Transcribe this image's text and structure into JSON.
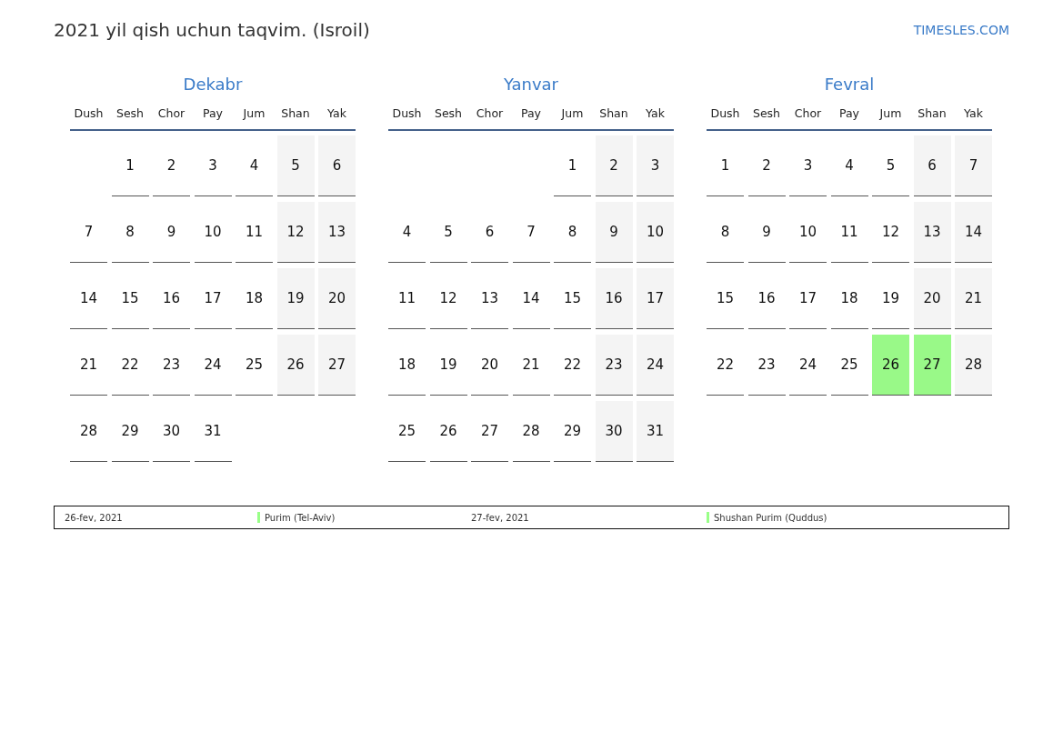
{
  "title": "2021 yil qish uchun taqvim. (Isroil)",
  "site": "TIMESLES.COM",
  "months": [
    {
      "name": "Dekabr",
      "weekdays": [
        "Dush",
        "Sesh",
        "Chor",
        "Pay",
        "Jum",
        "Shan",
        "Yak"
      ],
      "weeks": [
        [
          {
            "kind": "blank"
          },
          {
            "kind": "day",
            "day": "1"
          },
          {
            "kind": "day",
            "day": "2"
          },
          {
            "kind": "day",
            "day": "3"
          },
          {
            "kind": "day",
            "day": "4"
          },
          {
            "kind": "weekend",
            "day": "5"
          },
          {
            "kind": "weekend",
            "day": "6"
          }
        ],
        [
          {
            "kind": "day",
            "day": "7"
          },
          {
            "kind": "day",
            "day": "8"
          },
          {
            "kind": "day",
            "day": "9"
          },
          {
            "kind": "day",
            "day": "10"
          },
          {
            "kind": "day",
            "day": "11"
          },
          {
            "kind": "weekend",
            "day": "12"
          },
          {
            "kind": "weekend",
            "day": "13"
          }
        ],
        [
          {
            "kind": "day",
            "day": "14"
          },
          {
            "kind": "day",
            "day": "15"
          },
          {
            "kind": "day",
            "day": "16"
          },
          {
            "kind": "day",
            "day": "17"
          },
          {
            "kind": "day",
            "day": "18"
          },
          {
            "kind": "weekend",
            "day": "19"
          },
          {
            "kind": "weekend",
            "day": "20"
          }
        ],
        [
          {
            "kind": "day",
            "day": "21"
          },
          {
            "kind": "day",
            "day": "22"
          },
          {
            "kind": "day",
            "day": "23"
          },
          {
            "kind": "day",
            "day": "24"
          },
          {
            "kind": "day",
            "day": "25"
          },
          {
            "kind": "weekend",
            "day": "26"
          },
          {
            "kind": "weekend",
            "day": "27"
          }
        ],
        [
          {
            "kind": "day",
            "day": "28"
          },
          {
            "kind": "day",
            "day": "29"
          },
          {
            "kind": "day",
            "day": "30"
          },
          {
            "kind": "day",
            "day": "31"
          },
          {
            "kind": "blank"
          },
          {
            "kind": "blank"
          },
          {
            "kind": "blank"
          }
        ]
      ]
    },
    {
      "name": "Yanvar",
      "weekdays": [
        "Dush",
        "Sesh",
        "Chor",
        "Pay",
        "Jum",
        "Shan",
        "Yak"
      ],
      "weeks": [
        [
          {
            "kind": "blank"
          },
          {
            "kind": "blank"
          },
          {
            "kind": "blank"
          },
          {
            "kind": "blank"
          },
          {
            "kind": "day",
            "day": "1"
          },
          {
            "kind": "weekend",
            "day": "2"
          },
          {
            "kind": "weekend",
            "day": "3"
          }
        ],
        [
          {
            "kind": "day",
            "day": "4"
          },
          {
            "kind": "day",
            "day": "5"
          },
          {
            "kind": "day",
            "day": "6"
          },
          {
            "kind": "day",
            "day": "7"
          },
          {
            "kind": "day",
            "day": "8"
          },
          {
            "kind": "weekend",
            "day": "9"
          },
          {
            "kind": "weekend",
            "day": "10"
          }
        ],
        [
          {
            "kind": "day",
            "day": "11"
          },
          {
            "kind": "day",
            "day": "12"
          },
          {
            "kind": "day",
            "day": "13"
          },
          {
            "kind": "day",
            "day": "14"
          },
          {
            "kind": "day",
            "day": "15"
          },
          {
            "kind": "weekend",
            "day": "16"
          },
          {
            "kind": "weekend",
            "day": "17"
          }
        ],
        [
          {
            "kind": "day",
            "day": "18"
          },
          {
            "kind": "day",
            "day": "19"
          },
          {
            "kind": "day",
            "day": "20"
          },
          {
            "kind": "day",
            "day": "21"
          },
          {
            "kind": "day",
            "day": "22"
          },
          {
            "kind": "weekend",
            "day": "23"
          },
          {
            "kind": "weekend",
            "day": "24"
          }
        ],
        [
          {
            "kind": "day",
            "day": "25"
          },
          {
            "kind": "day",
            "day": "26"
          },
          {
            "kind": "day",
            "day": "27"
          },
          {
            "kind": "day",
            "day": "28"
          },
          {
            "kind": "day",
            "day": "29"
          },
          {
            "kind": "weekend",
            "day": "30"
          },
          {
            "kind": "weekend",
            "day": "31"
          }
        ]
      ]
    },
    {
      "name": "Fevral",
      "weekdays": [
        "Dush",
        "Sesh",
        "Chor",
        "Pay",
        "Jum",
        "Shan",
        "Yak"
      ],
      "weeks": [
        [
          {
            "kind": "day",
            "day": "1"
          },
          {
            "kind": "day",
            "day": "2"
          },
          {
            "kind": "day",
            "day": "3"
          },
          {
            "kind": "day",
            "day": "4"
          },
          {
            "kind": "day",
            "day": "5"
          },
          {
            "kind": "weekend",
            "day": "6"
          },
          {
            "kind": "weekend",
            "day": "7"
          }
        ],
        [
          {
            "kind": "day",
            "day": "8"
          },
          {
            "kind": "day",
            "day": "9"
          },
          {
            "kind": "day",
            "day": "10"
          },
          {
            "kind": "day",
            "day": "11"
          },
          {
            "kind": "day",
            "day": "12"
          },
          {
            "kind": "weekend",
            "day": "13"
          },
          {
            "kind": "weekend",
            "day": "14"
          }
        ],
        [
          {
            "kind": "day",
            "day": "15"
          },
          {
            "kind": "day",
            "day": "16"
          },
          {
            "kind": "day",
            "day": "17"
          },
          {
            "kind": "day",
            "day": "18"
          },
          {
            "kind": "day",
            "day": "19"
          },
          {
            "kind": "weekend",
            "day": "20"
          },
          {
            "kind": "weekend",
            "day": "21"
          }
        ],
        [
          {
            "kind": "day",
            "day": "22"
          },
          {
            "kind": "day",
            "day": "23"
          },
          {
            "kind": "day",
            "day": "24"
          },
          {
            "kind": "day",
            "day": "25"
          },
          {
            "kind": "holiday",
            "day": "26"
          },
          {
            "kind": "holiday",
            "day": "27"
          },
          {
            "kind": "weekend",
            "day": "28"
          }
        ]
      ]
    }
  ],
  "legend": [
    {
      "date": "26-fev, 2021",
      "name": "Purim (Tel-Aviv)",
      "color": "#99ff88"
    },
    {
      "date": "27-fev, 2021",
      "name": "Shushan Purim (Quddus)",
      "color": "#99ff88"
    }
  ]
}
